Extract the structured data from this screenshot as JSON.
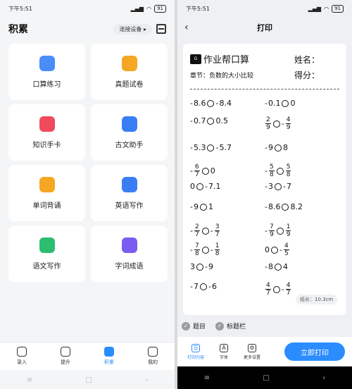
{
  "status": {
    "time": "下午5:51",
    "battery": "91"
  },
  "left": {
    "title": "积累",
    "connect_label": "连接设备",
    "cards": [
      {
        "label": "口算练习",
        "icon": "calculator-icon",
        "color": "#4a8df8"
      },
      {
        "label": "真题试卷",
        "icon": "exam-paper-icon",
        "color": "#f5a623"
      },
      {
        "label": "知识手卡",
        "icon": "knowledge-card-icon",
        "color": "#ef4b5c"
      },
      {
        "label": "古文助手",
        "icon": "classical-text-icon",
        "color": "#3a7ef5"
      },
      {
        "label": "单词背诵",
        "icon": "word-recite-icon",
        "color": "#f5a623"
      },
      {
        "label": "英语写作",
        "icon": "english-writing-icon",
        "color": "#3a7ef5"
      },
      {
        "label": "语文写作",
        "icon": "chinese-writing-icon",
        "color": "#2dbd6e"
      },
      {
        "label": "字词成语",
        "icon": "idiom-icon",
        "color": "#7b5cf0"
      }
    ],
    "tabs": [
      {
        "label": "录入",
        "icon": "record-icon",
        "active": false
      },
      {
        "label": "提升",
        "icon": "improve-icon",
        "active": false
      },
      {
        "label": "积累",
        "icon": "accumulate-icon",
        "active": true
      },
      {
        "label": "我的",
        "icon": "profile-icon",
        "active": false
      }
    ]
  },
  "right": {
    "title": "打印",
    "paper": {
      "logo_text": "作业帮口算",
      "name_label": "姓名：",
      "score_label": "得分：",
      "chapter": "章节：负数的大小比较",
      "problems": [
        {
          "left": "- 8.6",
          "right": "- 8.4"
        },
        {
          "left": "- 0.1",
          "right": "0"
        },
        {
          "left": "- 0.7",
          "right": "0.5"
        },
        {
          "left": "2/9",
          "right": "- 4/9"
        },
        {
          "left": "- 5.3",
          "right": "- 5.7"
        },
        {
          "left": "- 9",
          "right": "8"
        },
        {
          "left": "- 6/7",
          "right": "0"
        },
        {
          "left": "- 5/8",
          "right": "5/8"
        },
        {
          "left": "0",
          "right": "- 7.1"
        },
        {
          "left": "- 3",
          "right": "- 7"
        },
        {
          "left": "- 9",
          "right": "1"
        },
        {
          "left": "- 8.6",
          "right": "8.2"
        },
        {
          "left": "- 2/7",
          "right": "- 3/7"
        },
        {
          "left": "- 7/9",
          "right": "1/9"
        },
        {
          "left": "- 7/8",
          "right": "- 1/8"
        },
        {
          "left": "0",
          "right": "- 4/5"
        },
        {
          "left": "3",
          "right": "- 9"
        },
        {
          "left": "- 8",
          "right": "4"
        },
        {
          "left": "- 7",
          "right": "- 6"
        },
        {
          "left": "4/7",
          "right": "- 4/7"
        }
      ],
      "length_badge": "纸长：10.3cm"
    },
    "options": [
      {
        "label": "题目",
        "checked": true
      },
      {
        "label": "标题栏",
        "checked": true
      }
    ],
    "bottom_tabs": [
      {
        "label": "打印内容",
        "icon": "list-icon",
        "active": true
      },
      {
        "label": "字体",
        "icon": "font-icon",
        "active": false
      },
      {
        "label": "更多设置",
        "icon": "settings-icon",
        "active": false
      }
    ],
    "print_button": "立即打印"
  }
}
